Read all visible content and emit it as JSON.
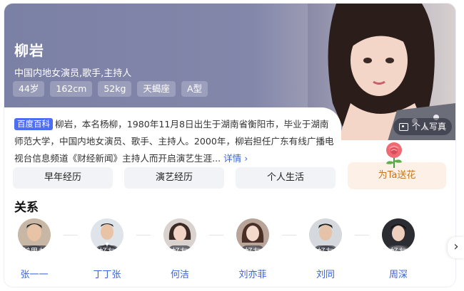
{
  "profile": {
    "name": "柳岩",
    "description": "中国内地女演员,歌手,主持人",
    "tags": [
      "44岁",
      "162cm",
      "52kg",
      "天蝎座",
      "A型"
    ],
    "photo_button": "个人写真"
  },
  "summary": {
    "source_badge": "百度百科",
    "text": "柳岩，本名杨柳，1980年11月8日出生于湖南省衡阳市，毕业于湖南师范大学，中国内地女演员、歌手、主持人。2000年，柳岩担任广东有线广播电视台信息频道《财经新闻》主持人而开启演艺生涯...",
    "more": "详情"
  },
  "sections": [
    "早年经历",
    "演艺经历",
    "个人生活"
  ],
  "flower": {
    "label": "为Ta送花"
  },
  "relations": {
    "title": "关系",
    "items": [
      {
        "name": "张一一",
        "relation": "前男友"
      },
      {
        "name": "丁丁张",
        "relation": "好友"
      },
      {
        "name": "何洁",
        "relation": "好友"
      },
      {
        "name": "刘亦菲",
        "relation": "好友"
      },
      {
        "name": "刘同",
        "relation": "好友"
      },
      {
        "name": "周深",
        "relation": "好友"
      }
    ]
  },
  "colors": {
    "hero": "#7b80a5",
    "link": "#3a63d8",
    "baike_badge": "#4e6ef2",
    "flower_text": "#c6741d"
  },
  "icons": {
    "photo": "photo-icon",
    "next": "chevron-right-icon",
    "flower": "rose-icon"
  }
}
